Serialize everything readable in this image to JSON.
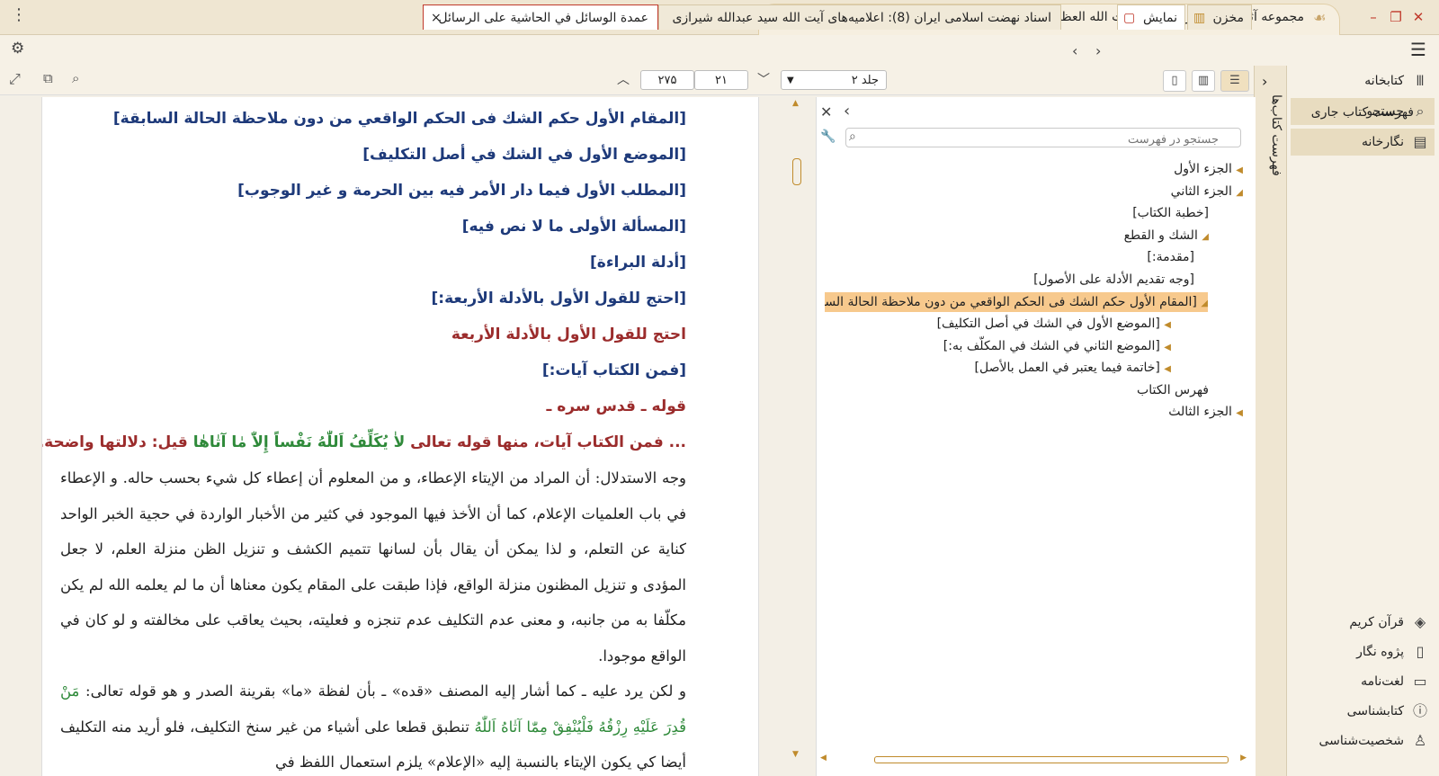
{
  "window": {
    "title": "مجموعه آثار فقیه و مرجع مجاهد آیت الله العظمی حاج سید عبدالله شیرازی (رحمة الله علیه)"
  },
  "tabs": {
    "doc_tab_1": "عمدة الوسائل في الحاشية على الرسائل",
    "doc_tab_2": "اسناد نهضت اسلامی ایران (8): اعلامیه‌های آیت الله سید عبدالله شیرازی",
    "show_label": "نمایش",
    "store_label": "مخزن",
    "close_glyph": "×",
    "new_tab_glyph": "+"
  },
  "sidebar": {
    "vertical_label": "فهرست کتاب‌ها",
    "top_items": [
      {
        "label": "کتابخانه",
        "icon": "library-icon"
      },
      {
        "label": "جستجو",
        "icon": "search-icon"
      },
      {
        "label": "نگارخانه",
        "icon": "gallery-icon"
      }
    ],
    "bottom_items": [
      {
        "label": "قرآن کریم",
        "icon": "quran-icon"
      },
      {
        "label": "پژوه نگار",
        "icon": "notebook-icon"
      },
      {
        "label": "لغت‌نامه",
        "icon": "dictionary-icon"
      },
      {
        "label": "کتابشناسی",
        "icon": "info-icon"
      },
      {
        "label": "شخصیت‌شناسی",
        "icon": "person-icon"
      }
    ]
  },
  "reader_toolbar": {
    "volume": "جلد ۲",
    "page_number": "۲۷۵",
    "total": "۲۱"
  },
  "toc": {
    "header": "فهرست کتاب جاری",
    "search_placeholder": "جستجو در فهرست",
    "items": [
      "الجزء الأول",
      "الجزء الثاني",
      "[خطبة الكتاب]",
      "الشك و القطع",
      "[مقدمة:]",
      "[وجه تقديم الأدلة على الأصول]",
      "[المقام الأول حكم الشك فی الحكم الواقعي من دون ملاحظة الحالة السابقة",
      "[الموضع الأول في الشك في أصل التكليف]",
      "[الموضع الثاني في الشك في المكلّف به:]",
      "[خاتمة فيما يعتبر في العمل بالأصل]",
      "فهرس الكتاب",
      "الجزء الثالث"
    ]
  },
  "content": {
    "headings": [
      "[المقام الأول حكم الشك فی الحكم الواقعي من دون ملاحظة الحالة السابقة]",
      "[الموضع الأول في الشك في أصل التكليف]",
      "[المطلب الأول فيما دار الأمر فيه بين الحرمة و غير الوجوب]",
      "[المسألة الأولى ما لا نص فيه]",
      "[أدلة البراءة]",
      "[احتج للقول الأول بالأدلة الأربعة:]"
    ],
    "red_heading_1": "احتج للقول الأول بالأدلة الأربعة",
    "heading_7": "[فمن الكتاب آيات:]",
    "red_heading_2": "قوله ـ قدس سره ـ",
    "quote_prefix": "... فمن الكتاب آيات، منها قوله تعالى ",
    "quote_verse": "لاٰ يُكَلِّفُ اَللّٰهُ نَفْساً إِلاّٰ مٰا آتٰاهٰا",
    "quote_suffix": " قيل: دلالتها واضحة...",
    "paragraph_1": "وجه الاستدلال: أن المراد من الإيتاء الإعطاء، و من المعلوم أن إعطاء كل شيء بحسب حاله. و الإعطاء في باب العلميات الإعلام، كما أن الأخذ فيها الموجود في كثير من الأخبار الواردة في حجية الخبر الواحد كناية عن التعلم، و لذا يمكن أن يقال بأن لسانها تتميم الكشف و تنزيل الظن منزلة العلم، لا جعل المؤدى و تنزيل المظنون منزلة الواقع، فإذا طبقت على المقام يكون معناها أن ما لم يعلمه الله لم يكن مكلّفا به من جانبه، و معنى عدم التكليف عدم تنجزه و فعليته، بحيث يعاقب على مخالفته و لو كان في الواقع موجودا.",
    "paragraph_2_a": "و لكن يرد عليه ـ كما أشار إليه المصنف «قده» ـ بأن لفظة «ما» بقرينة الصدر و هو قوله تعالى: ",
    "paragraph_2_verse": "مَنْ قُدِرَ عَلَيْهِ رِزْقُهُ فَلْيُنْفِقْ مِمّٰا آتٰاهُ اَللّٰهُ",
    "paragraph_2_b": " تنطبق قطعا على أشياء من غير سنخ التكليف، فلو أريد منه التكليف أيضا كي يكون الإيتاء بالنسبة إليه «الإعلام» يلزم استعمال اللفظ في"
  }
}
